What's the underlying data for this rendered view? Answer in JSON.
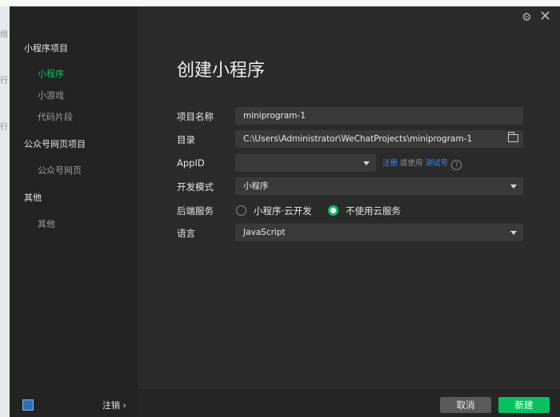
{
  "background": {
    "top_fragment": "组",
    "left_fragment_1": "行",
    "left_fragment_2": "行"
  },
  "sidebar": {
    "sections": [
      {
        "title": "小程序项目",
        "items": [
          "小程序",
          "小游戏",
          "代码片段"
        ]
      },
      {
        "title": "公众号网页项目",
        "items": [
          "公众号网页"
        ]
      },
      {
        "title": "其他",
        "items": [
          "其他"
        ]
      }
    ],
    "active_item": "小程序",
    "logout_label": "注销 ›"
  },
  "main": {
    "title": "创建小程序",
    "form": {
      "name_label": "项目名称",
      "name_value": "miniprogram-1",
      "dir_label": "目录",
      "dir_value": "C:\\Users\\Administrator\\WeChatProjects\\miniprogram-1",
      "appid_label": "AppID",
      "appid_value": "",
      "appid_register": "注册",
      "appid_or": " 或使用 ",
      "appid_test": "测试号",
      "mode_label": "开发模式",
      "mode_value": "小程序",
      "backend_label": "后端服务",
      "backend_options": [
        "小程序·云开发",
        "不使用云服务"
      ],
      "backend_selected": "不使用云服务",
      "lang_label": "语言",
      "lang_value": "JavaScript"
    }
  },
  "footer": {
    "cancel_label": "取消",
    "create_label": "新建"
  },
  "icons": {
    "settings": "gear-icon",
    "close": "close-icon",
    "folder": "folder-icon",
    "help": "question-icon"
  },
  "colors": {
    "accent": "#07c160",
    "link": "#3f8ef0",
    "window_bg": "#2b2b2b",
    "sidebar_bg": "#232323"
  }
}
